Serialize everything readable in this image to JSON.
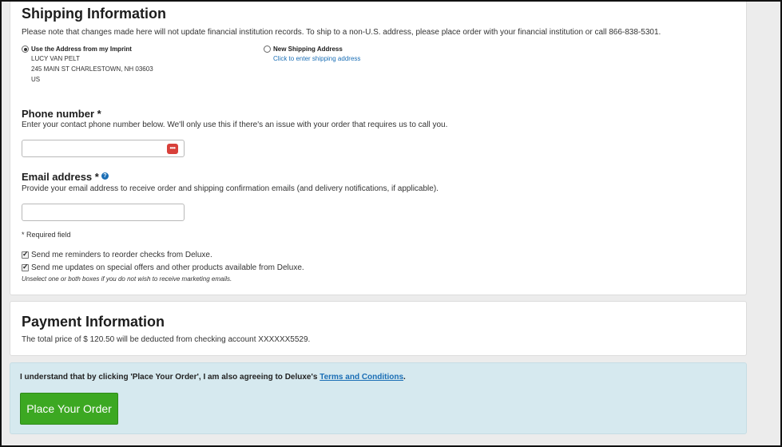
{
  "shipping": {
    "title": "Shipping Information",
    "note": "Please note that changes made here will not update financial institution records. To ship to a non-U.S. address, please place order with your financial institution or call 866-838-5301.",
    "imprint_option": {
      "label": "Use the Address from my Imprint",
      "selected": true,
      "lines": [
        "LUCY VAN PELT",
        "245 MAIN ST CHARLESTOWN,  NH  03603",
        "US"
      ]
    },
    "new_address_option": {
      "label": "New Shipping Address",
      "selected": false,
      "link": "Click to enter shipping address"
    }
  },
  "phone": {
    "title": "Phone number *",
    "description": "Enter your contact phone number below. We'll only use this if there's an issue with your order that requires us to call you.",
    "value": "",
    "icon": "password-manager-icon",
    "icon_glyph": "•••"
  },
  "email": {
    "title": "Email address *",
    "help_glyph": "?",
    "description": "Provide your email address to receive order and shipping confirmation emails (and delivery notifications, if applicable).",
    "value": ""
  },
  "required_note": "* Required field",
  "marketing": {
    "reorder_label": "Send me reminders to reorder checks from Deluxe.",
    "reorder_checked": true,
    "offers_label": "Send me updates on special offers and other products available from Deluxe.",
    "offers_checked": true,
    "hint": "Unselect one or both boxes if you do not wish to receive marketing emails."
  },
  "payment": {
    "title": "Payment Information",
    "text": "The total price of $ 120.50 will be deducted from checking account XXXXXX5529."
  },
  "agreement": {
    "text": "I understand that by clicking 'Place Your Order', I am also agreeing to Deluxe's",
    "link": "Terms and Conditions",
    "suffix": ".",
    "button": "Place Your Order"
  },
  "colors": {
    "accent_link": "#1a6eb5",
    "button_green": "#3ca822",
    "agree_bg": "#d6e9ef"
  }
}
